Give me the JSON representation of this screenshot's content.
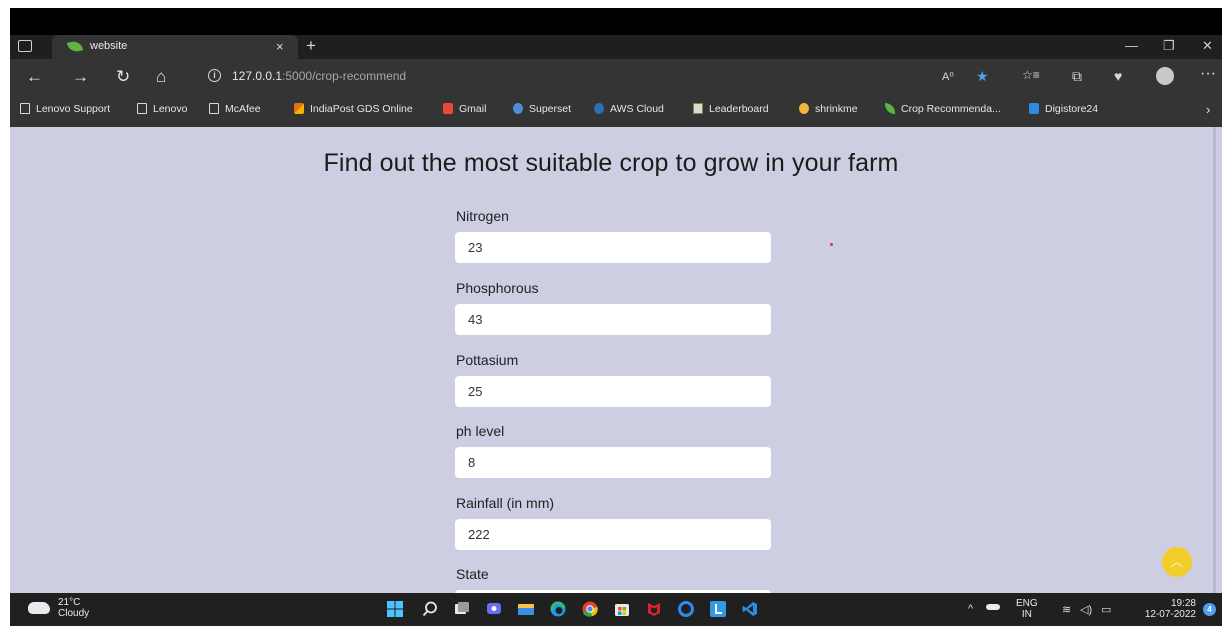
{
  "browser": {
    "tab": {
      "title": "website",
      "close": "×",
      "new_tab": "+"
    },
    "window_controls": {
      "minimize": "—",
      "restore": "❐",
      "close": "✕"
    },
    "nav": {
      "back": "←",
      "forward": "→",
      "reload": "↻",
      "home": "⌂"
    },
    "address": {
      "host": "127.0.0.1",
      "path": ":5000/crop-recommend"
    },
    "toolbar": {
      "read_aloud": "A⁰",
      "favorite": "★",
      "favorites_list": "☆≡",
      "collections": "⧉",
      "heart": "♥",
      "more": "···"
    },
    "bookmarks": [
      {
        "label": "Lenovo Support",
        "icon": "page-icon"
      },
      {
        "label": "Lenovo",
        "icon": "page-icon"
      },
      {
        "label": "McAfee",
        "icon": "page-icon"
      },
      {
        "label": "IndiaPost GDS Online",
        "icon": "mcafee-icon"
      },
      {
        "label": "Gmail",
        "icon": "gmail-icon"
      },
      {
        "label": "Superset",
        "icon": "superset-icon"
      },
      {
        "label": "AWS Cloud",
        "icon": "aws-icon"
      },
      {
        "label": "Leaderboard",
        "icon": "leaderboard-icon"
      },
      {
        "label": "shrinkme",
        "icon": "shrinkme-icon"
      },
      {
        "label": "Crop Recommenda...",
        "icon": "leaf-icon"
      },
      {
        "label": "Digistore24",
        "icon": "digistore-icon"
      }
    ],
    "bookmarks_more": "›"
  },
  "page": {
    "heading": "Find out the most suitable crop to grow in your farm",
    "fields": [
      {
        "label": "Nitrogen",
        "value": "23"
      },
      {
        "label": "Phosphorous",
        "value": "43"
      },
      {
        "label": "Pottasium",
        "value": "25"
      },
      {
        "label": "ph level",
        "value": "8"
      },
      {
        "label": "Rainfall (in mm)",
        "value": "222"
      },
      {
        "label": "State",
        "value": ""
      }
    ],
    "scroll_top": "︿"
  },
  "taskbar": {
    "weather": {
      "temp": "21°C",
      "condition": "Cloudy"
    },
    "apps": [
      "windows-start-icon",
      "search-icon",
      "task-view-icon",
      "chat-icon",
      "file-explorer-icon",
      "edge-icon",
      "chrome-icon",
      "store-icon",
      "mcafee-icon",
      "opera-icon",
      "launcher-icon",
      "vscode-icon"
    ],
    "tray": {
      "chevron": "^",
      "lang_top": "ENG",
      "lang_bottom": "IN",
      "wifi": "≋",
      "volume": "◁)",
      "battery": "▭"
    },
    "clock": {
      "time": "19:28",
      "date": "12-07-2022"
    },
    "notifications": "4"
  }
}
